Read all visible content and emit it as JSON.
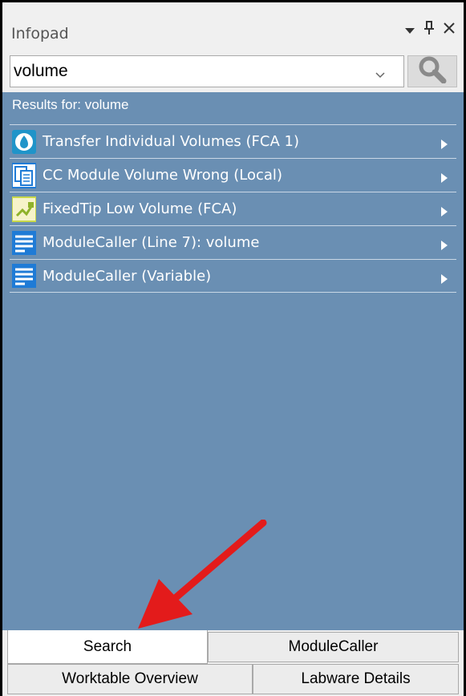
{
  "window": {
    "title": "Infopad"
  },
  "search": {
    "value": "volume",
    "placeholder": ""
  },
  "results": {
    "label": "Results for: volume",
    "items": [
      {
        "label": "Transfer Individual Volumes (FCA 1)",
        "icon": "water-drop-icon"
      },
      {
        "label": "CC Module Volume Wrong (Local)",
        "icon": "document-copy-icon"
      },
      {
        "label": "FixedTip Low Volume (FCA)",
        "icon": "fixed-tip-icon"
      },
      {
        "label": "ModuleCaller (Line 7): volume",
        "icon": "script-lines-icon"
      },
      {
        "label": "ModuleCaller (Variable)",
        "icon": "script-lines-icon"
      }
    ]
  },
  "tabs": {
    "search": "Search",
    "modulecaller": "ModuleCaller",
    "worktable": "Worktable Overview",
    "labware": "Labware Details",
    "active": "Search"
  },
  "colors": {
    "panel_background": "#6a8fb3",
    "annotation_arrow": "#e31b1b",
    "icon_blue": "#1f7bd6",
    "icon_green": "#c8d84a"
  }
}
